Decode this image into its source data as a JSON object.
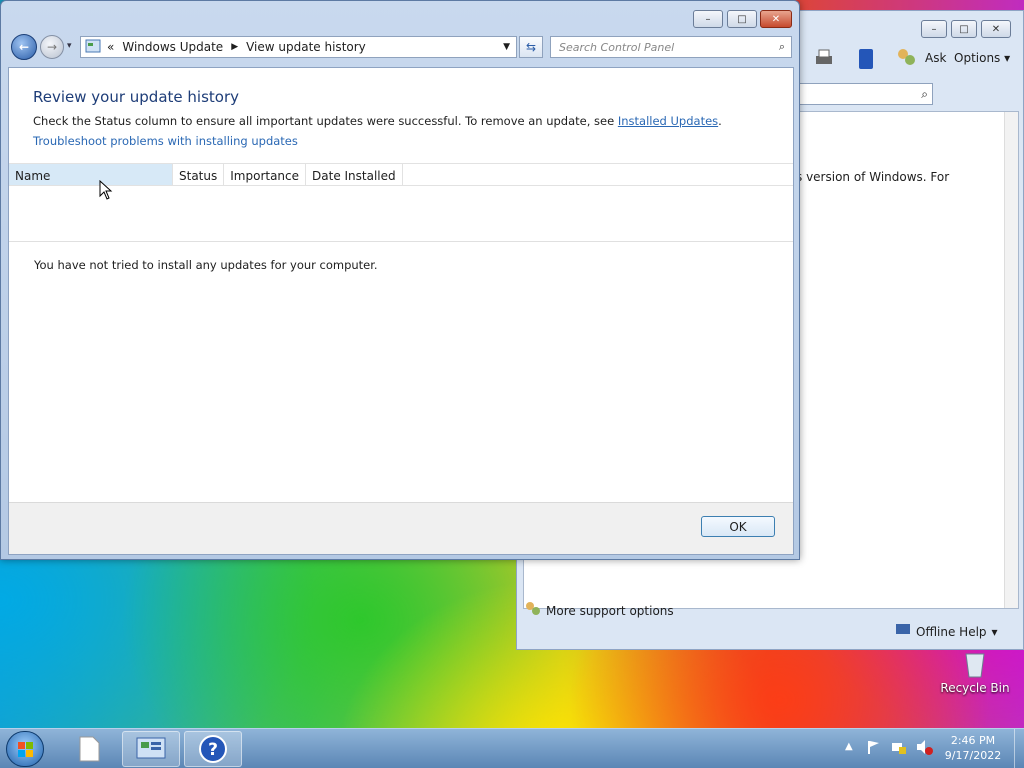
{
  "front_window": {
    "breadcrumb_sep": "«",
    "breadcrumb": [
      "Windows Update",
      "View update history"
    ],
    "search_placeholder": "Search Control Panel",
    "heading": "Review your update history",
    "description_prefix": "Check the Status column to ensure all important updates were successful. To remove an update, see ",
    "description_link": "Installed Updates",
    "description_suffix": ".",
    "troubleshoot_link": "Troubleshoot problems with installing updates",
    "columns": [
      "Name",
      "Status",
      "Importance",
      "Date Installed"
    ],
    "empty_message": "You have not tried to install any updates for your computer.",
    "ok_label": "OK",
    "caption_buttons": [
      "–",
      "□",
      "✕"
    ]
  },
  "back_window": {
    "toolbar": {
      "ask_label": "Ask",
      "options_label": "Options"
    },
    "partial_text": "s version of Windows. For",
    "more_support": "More support options",
    "offline_help": "Offline Help"
  },
  "desktop": {
    "recycle_bin_label": "Recycle Bin"
  },
  "taskbar": {
    "time": "2:46 PM",
    "date": "9/17/2022"
  },
  "colors": {
    "link": "#2a68b4",
    "heading": "#1e3d78",
    "selected_header": "#d7e9f7"
  }
}
